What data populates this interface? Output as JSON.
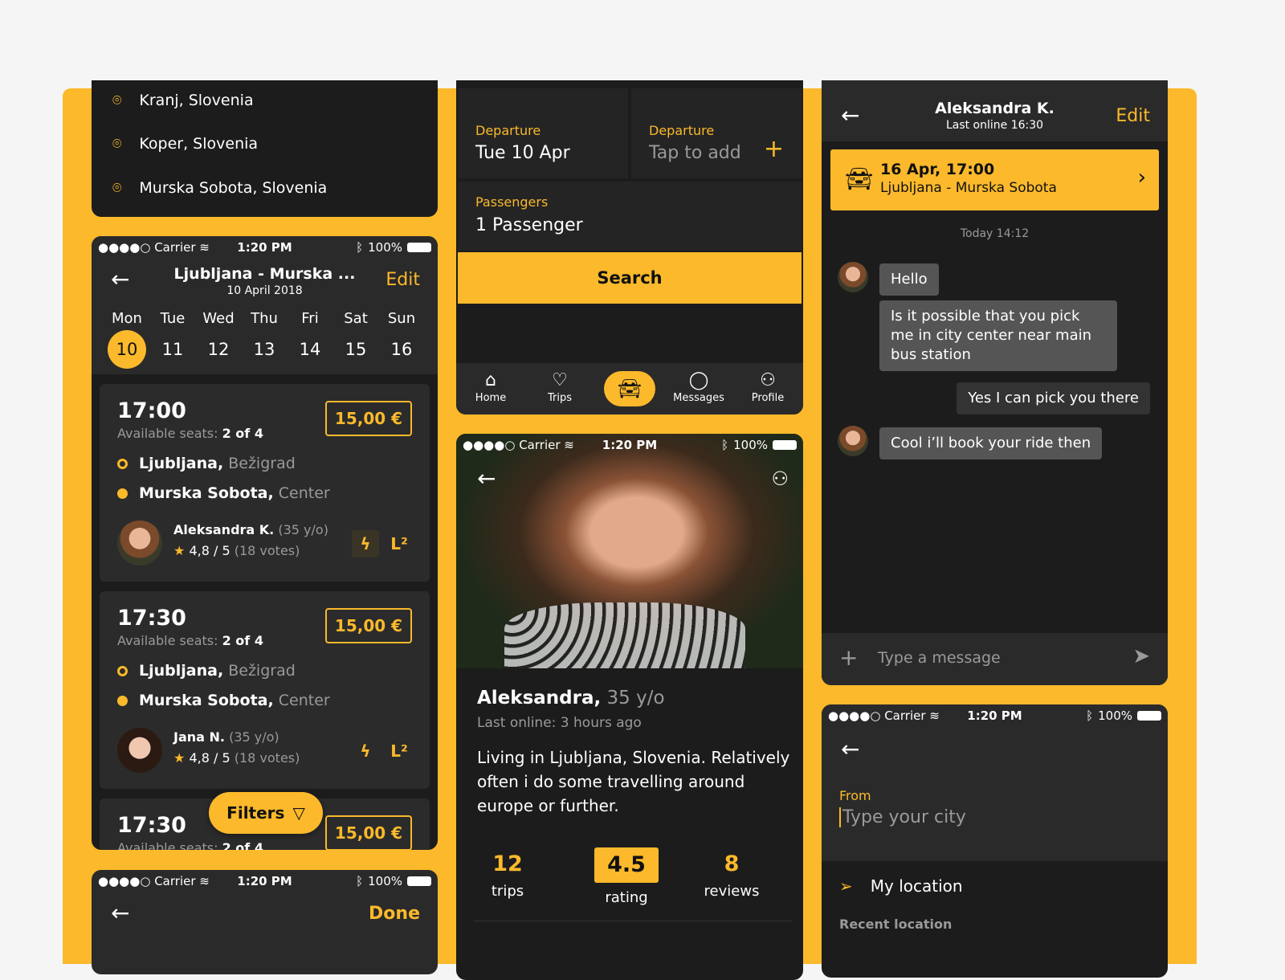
{
  "colors": {
    "accent": "#fbb92b",
    "panel": "#1c1c1c",
    "header": "#2a2a2a",
    "card": "#2b2b2b"
  },
  "status": {
    "carrier": "●●●●○ Carrier",
    "time": "1:20 PM",
    "battery": "100%"
  },
  "locations": [
    "Kranj, Slovenia",
    "Koper, Slovenia",
    "Murska Sobota, Slovenia"
  ],
  "results": {
    "title": "Ljubljana - Murska ...",
    "subtitle": "10 April 2018",
    "edit": "Edit",
    "days": [
      {
        "d": "Mon",
        "n": "10"
      },
      {
        "d": "Tue",
        "n": "11"
      },
      {
        "d": "Wed",
        "n": "12"
      },
      {
        "d": "Thu",
        "n": "13"
      },
      {
        "d": "Fri",
        "n": "14"
      },
      {
        "d": "Sat",
        "n": "15"
      },
      {
        "d": "Sun",
        "n": "16"
      }
    ],
    "seats_label": "Available seats:",
    "rides": [
      {
        "time": "17:00",
        "seats": "2 of 4",
        "price": "15,00 €",
        "from_city": "Ljubljana,",
        "from_area": "Bežigrad",
        "to_city": "Murska Sobota,",
        "to_area": "Center",
        "driver": "Aleksandra K.",
        "age": "(35 y/o)",
        "rating": "4,8 / 5",
        "votes": "(18 votes)"
      },
      {
        "time": "17:30",
        "seats": "2 of 4",
        "price": "15,00 €",
        "from_city": "Ljubljana,",
        "from_area": "Bežigrad",
        "to_city": "Murska Sobota,",
        "to_area": "Center",
        "driver": "Jana N.",
        "age": "(35 y/o)",
        "rating": "4,8 / 5",
        "votes": "(18 votes)"
      },
      {
        "time": "17:30",
        "seats": "2 of 4",
        "price": "15,00 €"
      }
    ],
    "filters": "Filters"
  },
  "done_screen": {
    "done": "Done"
  },
  "search": {
    "departure_label": "Departure",
    "departure_value": "Tue 10 Apr",
    "return_label": "Departure",
    "return_placeholder": "Tap to add",
    "passengers_label": "Passengers",
    "passengers_value": "1 Passenger",
    "search_button": "Search",
    "tabs": [
      {
        "label": "Home",
        "icon": "home-icon"
      },
      {
        "label": "Trips",
        "icon": "pin-icon"
      },
      {
        "label": "",
        "icon": "car-icon"
      },
      {
        "label": "Messages",
        "icon": "chat-icon"
      },
      {
        "label": "Profile",
        "icon": "user-icon"
      }
    ]
  },
  "profile": {
    "name": "Aleksandra,",
    "age": "35 y/o",
    "last_online": "Last online: 3 hours ago",
    "bio": "Living in Ljubljana, Slovenia. Relatively often i do some travelling around europe or further.",
    "stats": [
      {
        "value": "12",
        "label": "trips"
      },
      {
        "value": "4.5",
        "label": "rating"
      },
      {
        "value": "8",
        "label": "reviews"
      }
    ]
  },
  "chat": {
    "name": "Aleksandra K.",
    "last_online": "Last online 16:30",
    "edit": "Edit",
    "ride_date": "16 Apr, 17:00",
    "ride_route": "Ljubljana - Murska Sobota",
    "day_stamp": "Today 14:12",
    "messages": [
      "Hello",
      "Is it possible that you pick me in city center near main bus station",
      "Yes I can pick you there",
      "Cool i’ll book your ride then"
    ],
    "input_placeholder": "Type a message"
  },
  "city": {
    "from_label": "From",
    "placeholder": "Type your city",
    "my_location": "My location",
    "recent": "Recent location"
  }
}
